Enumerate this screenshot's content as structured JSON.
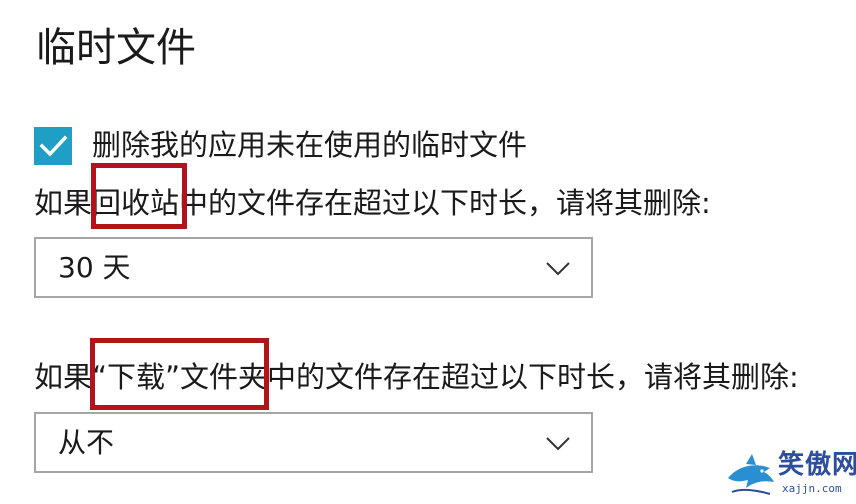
{
  "section": {
    "title": "临时文件"
  },
  "delete_temp_files": {
    "checked": true,
    "label": "删除我的应用未在使用的临时文件"
  },
  "recycle_bin": {
    "label": "如果回收站中的文件存在超过以下时长，请将其删除:",
    "selected": "30 天"
  },
  "downloads": {
    "label": "如果“下载”文件夹中的文件存在超过以下时长，请将其删除:",
    "selected": "从不"
  },
  "watermark": {
    "text": "笑傲网",
    "sub": "xajjn.com"
  },
  "colors": {
    "accent": "#1f9ec6",
    "highlight": "#b3141c",
    "dropdown_border": "#a6a6a6",
    "watermark": "#2d4e9e"
  },
  "icons": {
    "checkbox": "checkmark-icon",
    "dropdown": "chevron-down-icon",
    "watermark": "shark-logo-icon"
  }
}
